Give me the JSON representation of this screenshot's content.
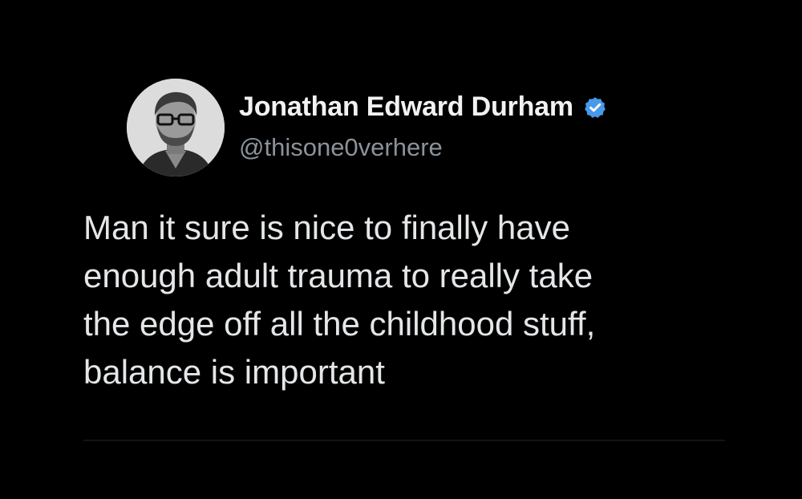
{
  "author": {
    "display_name": "Jonathan Edward Durham",
    "handle": "@thisone0verhere",
    "verified": true,
    "avatar_icon": "profile-photo",
    "verified_icon": "verified-badge-icon",
    "verified_color": "#4a99e9"
  },
  "tweet": {
    "lines": [
      "Man it sure is nice to finally have",
      "enough adult trauma to really take",
      "the edge off all the childhood stuff,",
      "balance is important"
    ]
  },
  "colors": {
    "background": "#000000",
    "name": "#f2f2f2",
    "handle": "#8b9299",
    "text": "#e4e6e8"
  }
}
